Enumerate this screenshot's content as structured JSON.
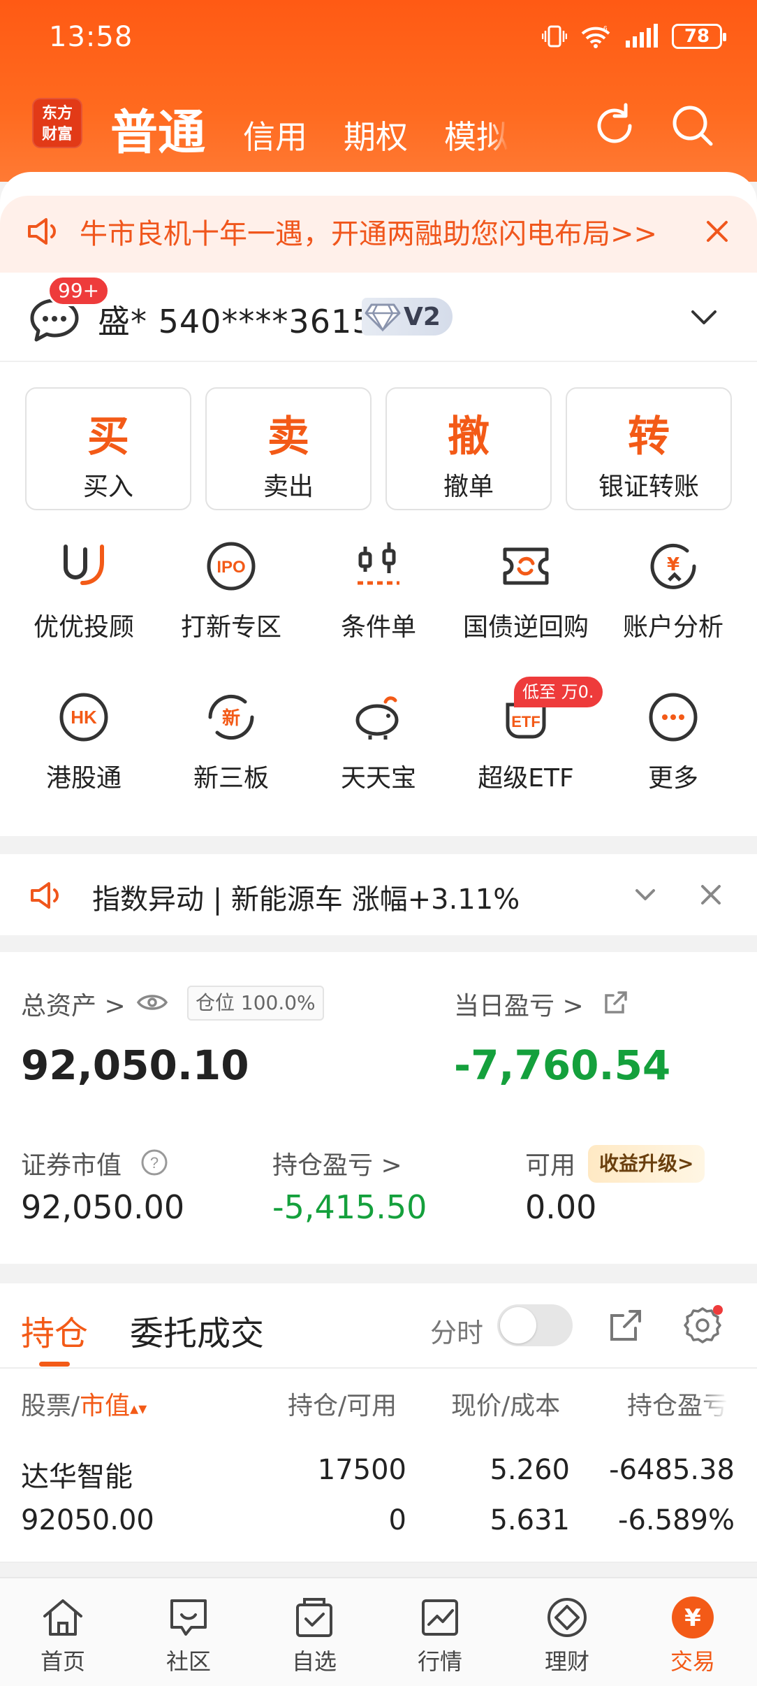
{
  "status_bar": {
    "time": "13:58",
    "battery": "78"
  },
  "header": {
    "logo_line1": "东方",
    "logo_line2": "财富",
    "tabs": [
      "普通",
      "信用",
      "期权",
      "模拟"
    ]
  },
  "promo": {
    "text": "牛市良机十年一遇，开通两融助您闪电布局>>"
  },
  "account": {
    "badge": "99+",
    "name": "盛* 540****3615",
    "level": "V2"
  },
  "quick_actions": [
    {
      "big": "买",
      "label": "买入"
    },
    {
      "big": "卖",
      "label": "卖出"
    },
    {
      "big": "撤",
      "label": "撤单"
    },
    {
      "big": "转",
      "label": "银证转账"
    }
  ],
  "grid": [
    {
      "label": "优优投顾",
      "icon": "youyou-icon"
    },
    {
      "label": "打新专区",
      "icon": "ipo-icon"
    },
    {
      "label": "条件单",
      "icon": "condition-order-icon"
    },
    {
      "label": "国债逆回购",
      "icon": "repo-icon"
    },
    {
      "label": "账户分析",
      "icon": "account-analysis-icon"
    },
    {
      "label": "港股通",
      "icon": "hk-icon"
    },
    {
      "label": "新三板",
      "icon": "new-third-board-icon"
    },
    {
      "label": "天天宝",
      "icon": "piggy-bank-icon"
    },
    {
      "label": "超级ETF",
      "icon": "etf-icon"
    },
    {
      "label": "更多",
      "icon": "more-icon"
    }
  ],
  "etf_badge": "低至 万0.",
  "alert": {
    "text": "指数异动 | 新能源车 涨幅+3.11%"
  },
  "assets": {
    "total_label": "总资产 >",
    "position_pill": "仓位 100.0%",
    "total_value": "92,050.10",
    "daily_pnl_label": "当日盈亏 >",
    "daily_pnl_value": "-7,760.54",
    "market_value_label": "证券市值",
    "market_value": "92,050.00",
    "holding_pnl_label": "持仓盈亏 >",
    "holding_pnl": "-5,415.50",
    "available_label": "可用",
    "available_value": "0.00",
    "upgrade_label": "收益升级>"
  },
  "holdings": {
    "tab_active": "持仓",
    "tab_other": "委托成交",
    "fen_label": "分时",
    "headers": {
      "stock": "股票/",
      "market_value": "市值",
      "qty": "持仓/可用",
      "price": "现价/成本",
      "pnl": "持仓盈亏"
    },
    "rows": [
      {
        "name": "达华智能",
        "value": "92050.00",
        "qty": "17500",
        "avail": "0",
        "price": "5.260",
        "cost": "5.631",
        "pnl": "-6485.38",
        "pnl_pct": "-6.589%"
      }
    ]
  },
  "bottom_nav": [
    {
      "label": "首页",
      "icon": "home-icon"
    },
    {
      "label": "社区",
      "icon": "community-icon"
    },
    {
      "label": "自选",
      "icon": "watchlist-icon"
    },
    {
      "label": "行情",
      "icon": "market-icon"
    },
    {
      "label": "理财",
      "icon": "wealth-icon"
    },
    {
      "label": "交易",
      "icon": "trade-icon"
    }
  ],
  "colors": {
    "brand": "#f35a17",
    "loss": "#14a03c",
    "badge": "#ee3b3b"
  }
}
